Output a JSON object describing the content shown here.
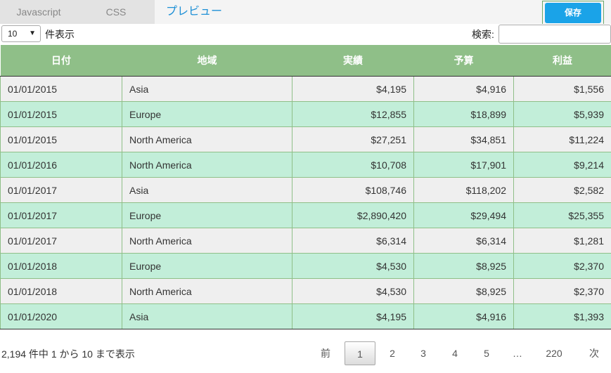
{
  "tabs": {
    "javascript": "Javascript",
    "css": "CSS",
    "preview": "プレビュー"
  },
  "save_label": "保存",
  "length": {
    "value": "10",
    "label": "件表示"
  },
  "search": {
    "label": "検索:",
    "value": ""
  },
  "table": {
    "headers": [
      "日付",
      "地域",
      "実績",
      "予算",
      "利益"
    ],
    "rows": [
      [
        "01/01/2015",
        "Asia",
        "$4,195",
        "$4,916",
        "$1,556"
      ],
      [
        "01/01/2015",
        "Europe",
        "$12,855",
        "$18,899",
        "$5,939"
      ],
      [
        "01/01/2015",
        "North America",
        "$27,251",
        "$34,851",
        "$11,224"
      ],
      [
        "01/01/2016",
        "North America",
        "$10,708",
        "$17,901",
        "$9,214"
      ],
      [
        "01/01/2017",
        "Asia",
        "$108,746",
        "$118,202",
        "$2,582"
      ],
      [
        "01/01/2017",
        "Europe",
        "$2,890,420",
        "$29,494",
        "$25,355"
      ],
      [
        "01/01/2017",
        "North America",
        "$6,314",
        "$6,314",
        "$1,281"
      ],
      [
        "01/01/2018",
        "Europe",
        "$4,530",
        "$8,925",
        "$2,370"
      ],
      [
        "01/01/2018",
        "North America",
        "$4,530",
        "$8,925",
        "$2,370"
      ],
      [
        "01/01/2020",
        "Asia",
        "$4,195",
        "$4,916",
        "$1,393"
      ]
    ]
  },
  "info": "2,194 件中 1 から 10 まで表示",
  "pagination": {
    "prev": "前",
    "pages": [
      "1",
      "2",
      "3",
      "4",
      "5"
    ],
    "ellipsis": "…",
    "last": "220",
    "next": "次",
    "current": "1"
  },
  "colors": {
    "header": "#8fbf88",
    "row_alt": "#c2eed9",
    "row": "#efefef",
    "save": "#1aa3e8",
    "preview_tab": "#1e90d6"
  }
}
